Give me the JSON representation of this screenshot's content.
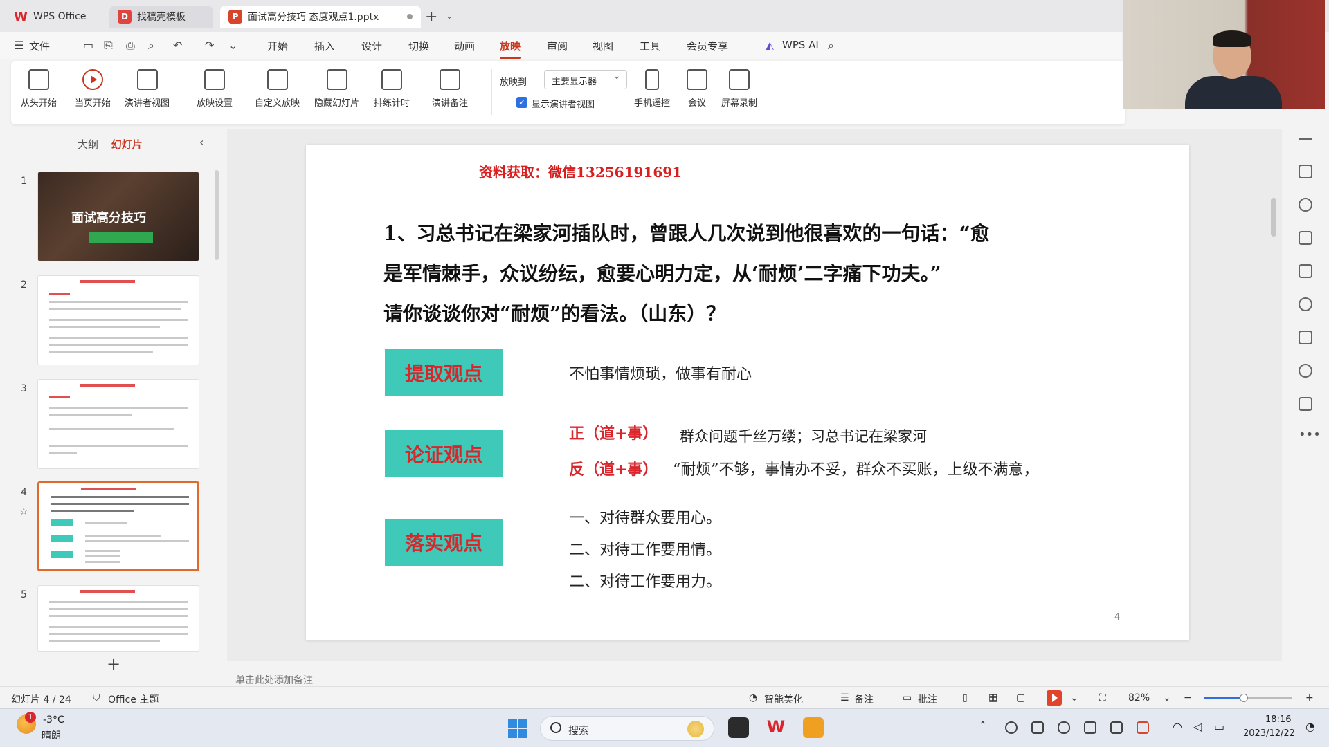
{
  "tabs": {
    "wps": "WPS Office",
    "template": "找稿壳模板",
    "file": "面试高分技巧 态度观点1.pptx"
  },
  "menu": {
    "file": "文件",
    "items": [
      "开始",
      "插入",
      "设计",
      "切换",
      "动画",
      "放映",
      "审阅",
      "视图",
      "工具",
      "会员专享"
    ],
    "active": "放映",
    "wps_ai": "WPS AI"
  },
  "ribbon": {
    "from_start": "从头开始",
    "current_start": "当页开始",
    "presenter_view": "演讲者视图",
    "show_settings": "放映设置",
    "custom_show": "自定义放映",
    "hide_slide": "隐藏幻灯片",
    "rehearse_timing": "排练计时",
    "speaker_notes": "演讲备注",
    "play_to_label": "放映到",
    "play_to_value": "主要显示器",
    "show_presenter_view": "显示演讲者视图",
    "phone_remote": "手机遥控",
    "meeting": "会议",
    "screen_record": "屏幕录制"
  },
  "left_panel": {
    "outline_tab": "大纲",
    "slides_tab": "幻灯片",
    "thumbnails": [
      {
        "num": "1",
        "title": "面试高分技巧"
      },
      {
        "num": "2"
      },
      {
        "num": "3"
      },
      {
        "num": "4"
      },
      {
        "num": "5"
      }
    ],
    "selected": 4
  },
  "slide": {
    "header": "资料获取：微信13256191691",
    "question_line1": "1、习总书记在梁家河插队时，曾跟人几次说到他很喜欢的一句话：“愈",
    "question_line2": "是军情棘手，众议纷纭，愈要心明力定，从‘耐烦’二字痛下功夫。”",
    "question_line3": "请你谈谈你对“耐烦”的看法。（山东）？",
    "label1": "提取观点",
    "label2": "论证观点",
    "label3": "落实观点",
    "point1": "不怕事情烦琐，做事有耐心",
    "pro_label": "正（道+事）",
    "pro_text": "群众问题千丝万缕；习总书记在梁家河",
    "con_label": "反（道+事）",
    "con_text": "“耐烦”不够，事情办不妥，群众不买账，上级不满意，",
    "action1": "一、对待群众要用心。",
    "action2": "二、对待工作要用情。",
    "action3": "二、对待工作要用力。",
    "page_number": "4"
  },
  "notes_placeholder": "单击此处添加备注",
  "status": {
    "slide_counter": "幻灯片 4 / 24",
    "theme": "Office 主题",
    "beautify": "智能美化",
    "notes": "备注",
    "comments": "批注",
    "zoom": "82%",
    "zoom_fraction": 0.45
  },
  "taskbar": {
    "temperature": "-3°C",
    "weather": "晴朗",
    "weather_badge": "1",
    "search": "搜索",
    "time": "18:16",
    "date": "2023/12/22"
  },
  "colors": {
    "accent": "#c7381f",
    "label_bg": "#3ec9b8",
    "label_text": "#d9262c"
  }
}
